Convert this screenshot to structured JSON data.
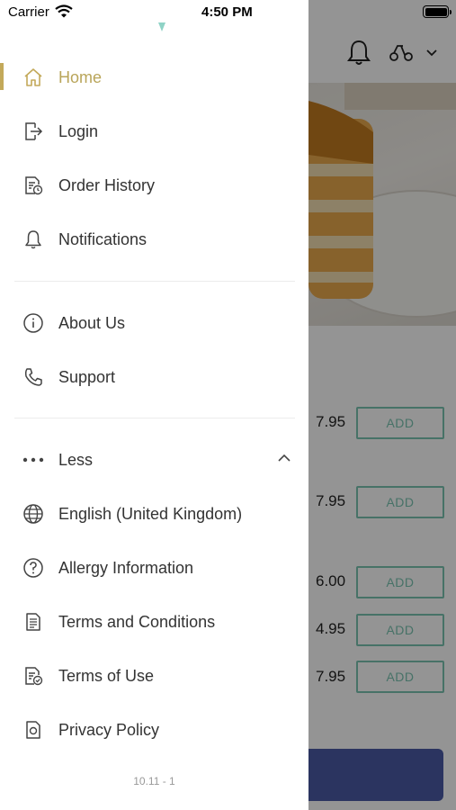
{
  "status_bar": {
    "carrier": "Carrier",
    "time": "4:50 PM"
  },
  "drawer": {
    "primary": [
      {
        "label": "Home",
        "icon": "home-icon",
        "active": true
      },
      {
        "label": "Login",
        "icon": "login-icon"
      },
      {
        "label": "Order History",
        "icon": "order-history-icon"
      },
      {
        "label": "Notifications",
        "icon": "bell-icon"
      }
    ],
    "info": [
      {
        "label": "About Us",
        "icon": "info-icon"
      },
      {
        "label": "Support",
        "icon": "phone-icon"
      }
    ],
    "more_toggle": {
      "label": "Less",
      "icon": "more-dots-icon"
    },
    "secondary": [
      {
        "label": "English (United Kingdom)",
        "icon": "globe-icon"
      },
      {
        "label": "Allergy Information",
        "icon": "question-icon"
      },
      {
        "label": "Terms and Conditions",
        "icon": "document-icon"
      },
      {
        "label": "Terms of Use",
        "icon": "document-check-icon"
      },
      {
        "label": "Privacy Policy",
        "icon": "privacy-icon"
      }
    ],
    "version": "10.11 - 1"
  },
  "background": {
    "menu_items": [
      {
        "price": "7.95",
        "button": "ADD"
      },
      {
        "price": "7.95",
        "button": "ADD"
      },
      {
        "price": "6.00",
        "button": "ADD"
      },
      {
        "price": "4.95",
        "button": "ADD"
      },
      {
        "price": "7.95",
        "button": "ADD"
      }
    ]
  },
  "colors": {
    "accent": "#c3a95a",
    "add_button": "#7bc4b2",
    "cta": "#4a5ba6"
  }
}
